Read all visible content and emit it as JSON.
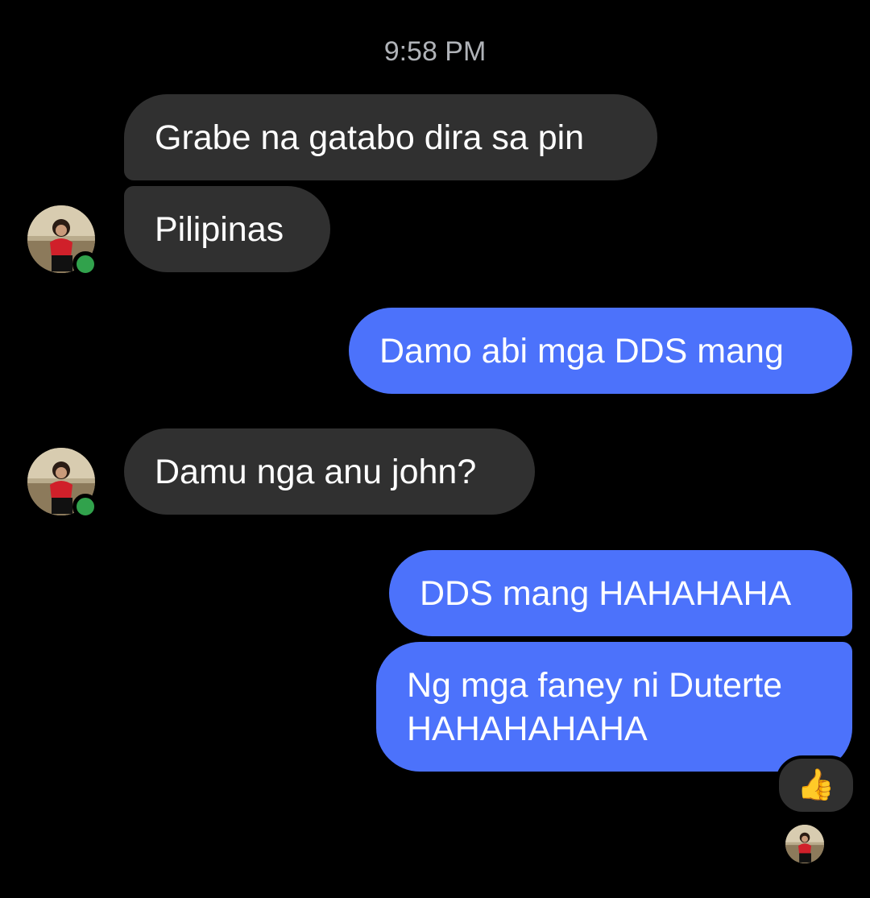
{
  "timestamp": "9:58 PM",
  "colors": {
    "background": "#000000",
    "incoming_bubble": "#303030",
    "outgoing_bubble": "#4c72fb",
    "presence_online": "#31a24c",
    "timestamp_text": "#b0b3b8"
  },
  "messages": [
    {
      "direction": "incoming",
      "text": "Grabe na gatabo dira sa pin"
    },
    {
      "direction": "incoming",
      "text": "Pilipinas"
    },
    {
      "direction": "outgoing",
      "text": "Damo abi mga DDS mang"
    },
    {
      "direction": "incoming",
      "text": "Damu nga anu john?"
    },
    {
      "direction": "outgoing",
      "text": "DDS mang HAHAHAHA"
    },
    {
      "direction": "outgoing",
      "text_line1": "Ng mga faney ni Duterte",
      "text_line2": "HAHAHAHAHA"
    }
  ],
  "reaction": {
    "icon": "thumbs-up-icon",
    "emoji": "👍"
  },
  "contact_status": "online",
  "read_receipt_icon": "avatar"
}
